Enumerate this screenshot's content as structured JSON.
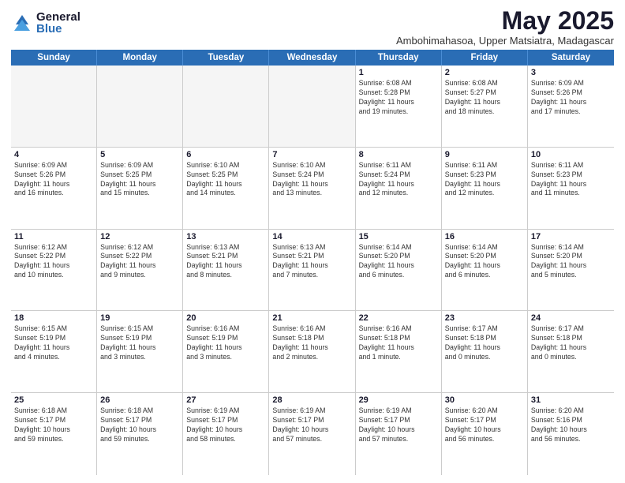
{
  "logo": {
    "general": "General",
    "blue": "Blue"
  },
  "title": "May 2025",
  "subtitle": "Ambohimahasoa, Upper Matsiatra, Madagascar",
  "weekdays": [
    "Sunday",
    "Monday",
    "Tuesday",
    "Wednesday",
    "Thursday",
    "Friday",
    "Saturday"
  ],
  "weeks": [
    [
      {
        "day": "",
        "info": ""
      },
      {
        "day": "",
        "info": ""
      },
      {
        "day": "",
        "info": ""
      },
      {
        "day": "",
        "info": ""
      },
      {
        "day": "1",
        "info": "Sunrise: 6:08 AM\nSunset: 5:28 PM\nDaylight: 11 hours\nand 19 minutes."
      },
      {
        "day": "2",
        "info": "Sunrise: 6:08 AM\nSunset: 5:27 PM\nDaylight: 11 hours\nand 18 minutes."
      },
      {
        "day": "3",
        "info": "Sunrise: 6:09 AM\nSunset: 5:26 PM\nDaylight: 11 hours\nand 17 minutes."
      }
    ],
    [
      {
        "day": "4",
        "info": "Sunrise: 6:09 AM\nSunset: 5:26 PM\nDaylight: 11 hours\nand 16 minutes."
      },
      {
        "day": "5",
        "info": "Sunrise: 6:09 AM\nSunset: 5:25 PM\nDaylight: 11 hours\nand 15 minutes."
      },
      {
        "day": "6",
        "info": "Sunrise: 6:10 AM\nSunset: 5:25 PM\nDaylight: 11 hours\nand 14 minutes."
      },
      {
        "day": "7",
        "info": "Sunrise: 6:10 AM\nSunset: 5:24 PM\nDaylight: 11 hours\nand 13 minutes."
      },
      {
        "day": "8",
        "info": "Sunrise: 6:11 AM\nSunset: 5:24 PM\nDaylight: 11 hours\nand 12 minutes."
      },
      {
        "day": "9",
        "info": "Sunrise: 6:11 AM\nSunset: 5:23 PM\nDaylight: 11 hours\nand 12 minutes."
      },
      {
        "day": "10",
        "info": "Sunrise: 6:11 AM\nSunset: 5:23 PM\nDaylight: 11 hours\nand 11 minutes."
      }
    ],
    [
      {
        "day": "11",
        "info": "Sunrise: 6:12 AM\nSunset: 5:22 PM\nDaylight: 11 hours\nand 10 minutes."
      },
      {
        "day": "12",
        "info": "Sunrise: 6:12 AM\nSunset: 5:22 PM\nDaylight: 11 hours\nand 9 minutes."
      },
      {
        "day": "13",
        "info": "Sunrise: 6:13 AM\nSunset: 5:21 PM\nDaylight: 11 hours\nand 8 minutes."
      },
      {
        "day": "14",
        "info": "Sunrise: 6:13 AM\nSunset: 5:21 PM\nDaylight: 11 hours\nand 7 minutes."
      },
      {
        "day": "15",
        "info": "Sunrise: 6:14 AM\nSunset: 5:20 PM\nDaylight: 11 hours\nand 6 minutes."
      },
      {
        "day": "16",
        "info": "Sunrise: 6:14 AM\nSunset: 5:20 PM\nDaylight: 11 hours\nand 6 minutes."
      },
      {
        "day": "17",
        "info": "Sunrise: 6:14 AM\nSunset: 5:20 PM\nDaylight: 11 hours\nand 5 minutes."
      }
    ],
    [
      {
        "day": "18",
        "info": "Sunrise: 6:15 AM\nSunset: 5:19 PM\nDaylight: 11 hours\nand 4 minutes."
      },
      {
        "day": "19",
        "info": "Sunrise: 6:15 AM\nSunset: 5:19 PM\nDaylight: 11 hours\nand 3 minutes."
      },
      {
        "day": "20",
        "info": "Sunrise: 6:16 AM\nSunset: 5:19 PM\nDaylight: 11 hours\nand 3 minutes."
      },
      {
        "day": "21",
        "info": "Sunrise: 6:16 AM\nSunset: 5:18 PM\nDaylight: 11 hours\nand 2 minutes."
      },
      {
        "day": "22",
        "info": "Sunrise: 6:16 AM\nSunset: 5:18 PM\nDaylight: 11 hours\nand 1 minute."
      },
      {
        "day": "23",
        "info": "Sunrise: 6:17 AM\nSunset: 5:18 PM\nDaylight: 11 hours\nand 0 minutes."
      },
      {
        "day": "24",
        "info": "Sunrise: 6:17 AM\nSunset: 5:18 PM\nDaylight: 11 hours\nand 0 minutes."
      }
    ],
    [
      {
        "day": "25",
        "info": "Sunrise: 6:18 AM\nSunset: 5:17 PM\nDaylight: 10 hours\nand 59 minutes."
      },
      {
        "day": "26",
        "info": "Sunrise: 6:18 AM\nSunset: 5:17 PM\nDaylight: 10 hours\nand 59 minutes."
      },
      {
        "day": "27",
        "info": "Sunrise: 6:19 AM\nSunset: 5:17 PM\nDaylight: 10 hours\nand 58 minutes."
      },
      {
        "day": "28",
        "info": "Sunrise: 6:19 AM\nSunset: 5:17 PM\nDaylight: 10 hours\nand 57 minutes."
      },
      {
        "day": "29",
        "info": "Sunrise: 6:19 AM\nSunset: 5:17 PM\nDaylight: 10 hours\nand 57 minutes."
      },
      {
        "day": "30",
        "info": "Sunrise: 6:20 AM\nSunset: 5:17 PM\nDaylight: 10 hours\nand 56 minutes."
      },
      {
        "day": "31",
        "info": "Sunrise: 6:20 AM\nSunset: 5:16 PM\nDaylight: 10 hours\nand 56 minutes."
      }
    ]
  ]
}
